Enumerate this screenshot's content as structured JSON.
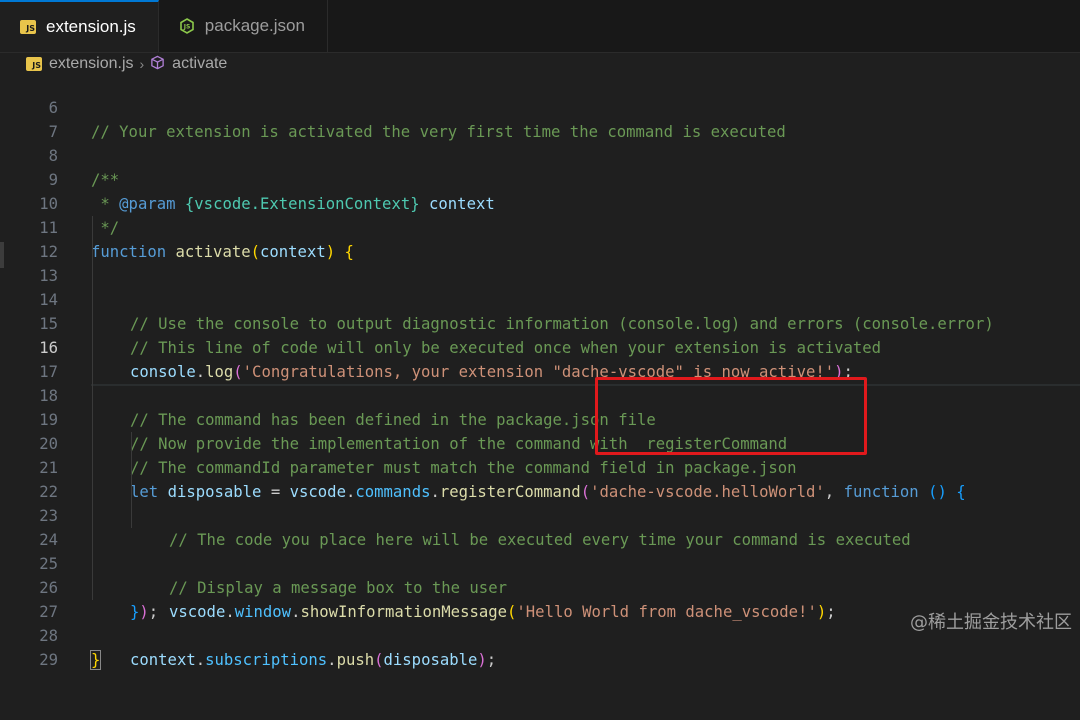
{
  "tabs": [
    {
      "label": "extension.js",
      "icon": "js-file-icon",
      "active": true
    },
    {
      "label": "package.json",
      "icon": "nodejs-icon",
      "active": false
    }
  ],
  "breadcrumb": {
    "file": "extension.js",
    "symbol": "activate"
  },
  "editor": {
    "current_line": 16,
    "lines": [
      {
        "n": "6"
      },
      {
        "n": "7"
      },
      {
        "n": "8"
      },
      {
        "n": "9"
      },
      {
        "n": "10"
      },
      {
        "n": "11"
      },
      {
        "n": "12"
      },
      {
        "n": "13"
      },
      {
        "n": "14"
      },
      {
        "n": "15"
      },
      {
        "n": "16"
      },
      {
        "n": "17"
      },
      {
        "n": "18"
      },
      {
        "n": "19"
      },
      {
        "n": "20"
      },
      {
        "n": "21"
      },
      {
        "n": "22"
      },
      {
        "n": "23"
      },
      {
        "n": "24"
      },
      {
        "n": "25"
      },
      {
        "n": "26"
      },
      {
        "n": "27"
      },
      {
        "n": "28"
      },
      {
        "n": "29"
      }
    ],
    "code": {
      "l6": "// Your extension is activated the very first time the command is executed",
      "l8": "/**",
      "l9_star": " * ",
      "l9_tag": "@param",
      "l9_type": "{vscode.ExtensionContext}",
      "l9_name": "context",
      "l10": " */",
      "l11_kw": "function",
      "l11_fn": "activate",
      "l11_param": "context",
      "l13": "// Use the console to output diagnostic information (console.log) and errors (console.error)",
      "l14": "// This line of code will only be executed once when your extension is activated",
      "l15_obj": "console",
      "l15_fn": "log",
      "l15_str": "'Congratulations, your extension \"dache-vscode\" is now active!'",
      "l17": "// The command has been defined in the package.json file",
      "l18": "// Now provide the implementation of the command with  registerCommand",
      "l19": "// The commandId parameter must match the command field in package.json",
      "l20_kw": "let",
      "l20_var": "disposable",
      "l20_obj": "vscode",
      "l20_prop": "commands",
      "l20_fn": "registerCommand",
      "l20_str": "'dache-vscode.helloWorld'",
      "l20_kw2": "function",
      "l21": "// The code you place here will be executed every time your command is executed",
      "l23": "// Display a message box to the user",
      "l24_obj": "vscode",
      "l24_prop": "window",
      "l24_fn": "showInformationMessage",
      "l24_str": "'Hello World from dache_vscode!'",
      "l27_obj": "context",
      "l27_prop": "subscriptions",
      "l27_fn": "push",
      "l27_arg": "disposable"
    }
  },
  "annotation": {
    "color": "#e0191c"
  },
  "watermark": "@稀土掘金技术社区",
  "colors": {
    "accent": "#0078d4",
    "background": "#1f1f1f",
    "comment": "#6a9955",
    "keyword": "#569cd6",
    "string": "#ce9178",
    "function": "#dcdcaa"
  }
}
